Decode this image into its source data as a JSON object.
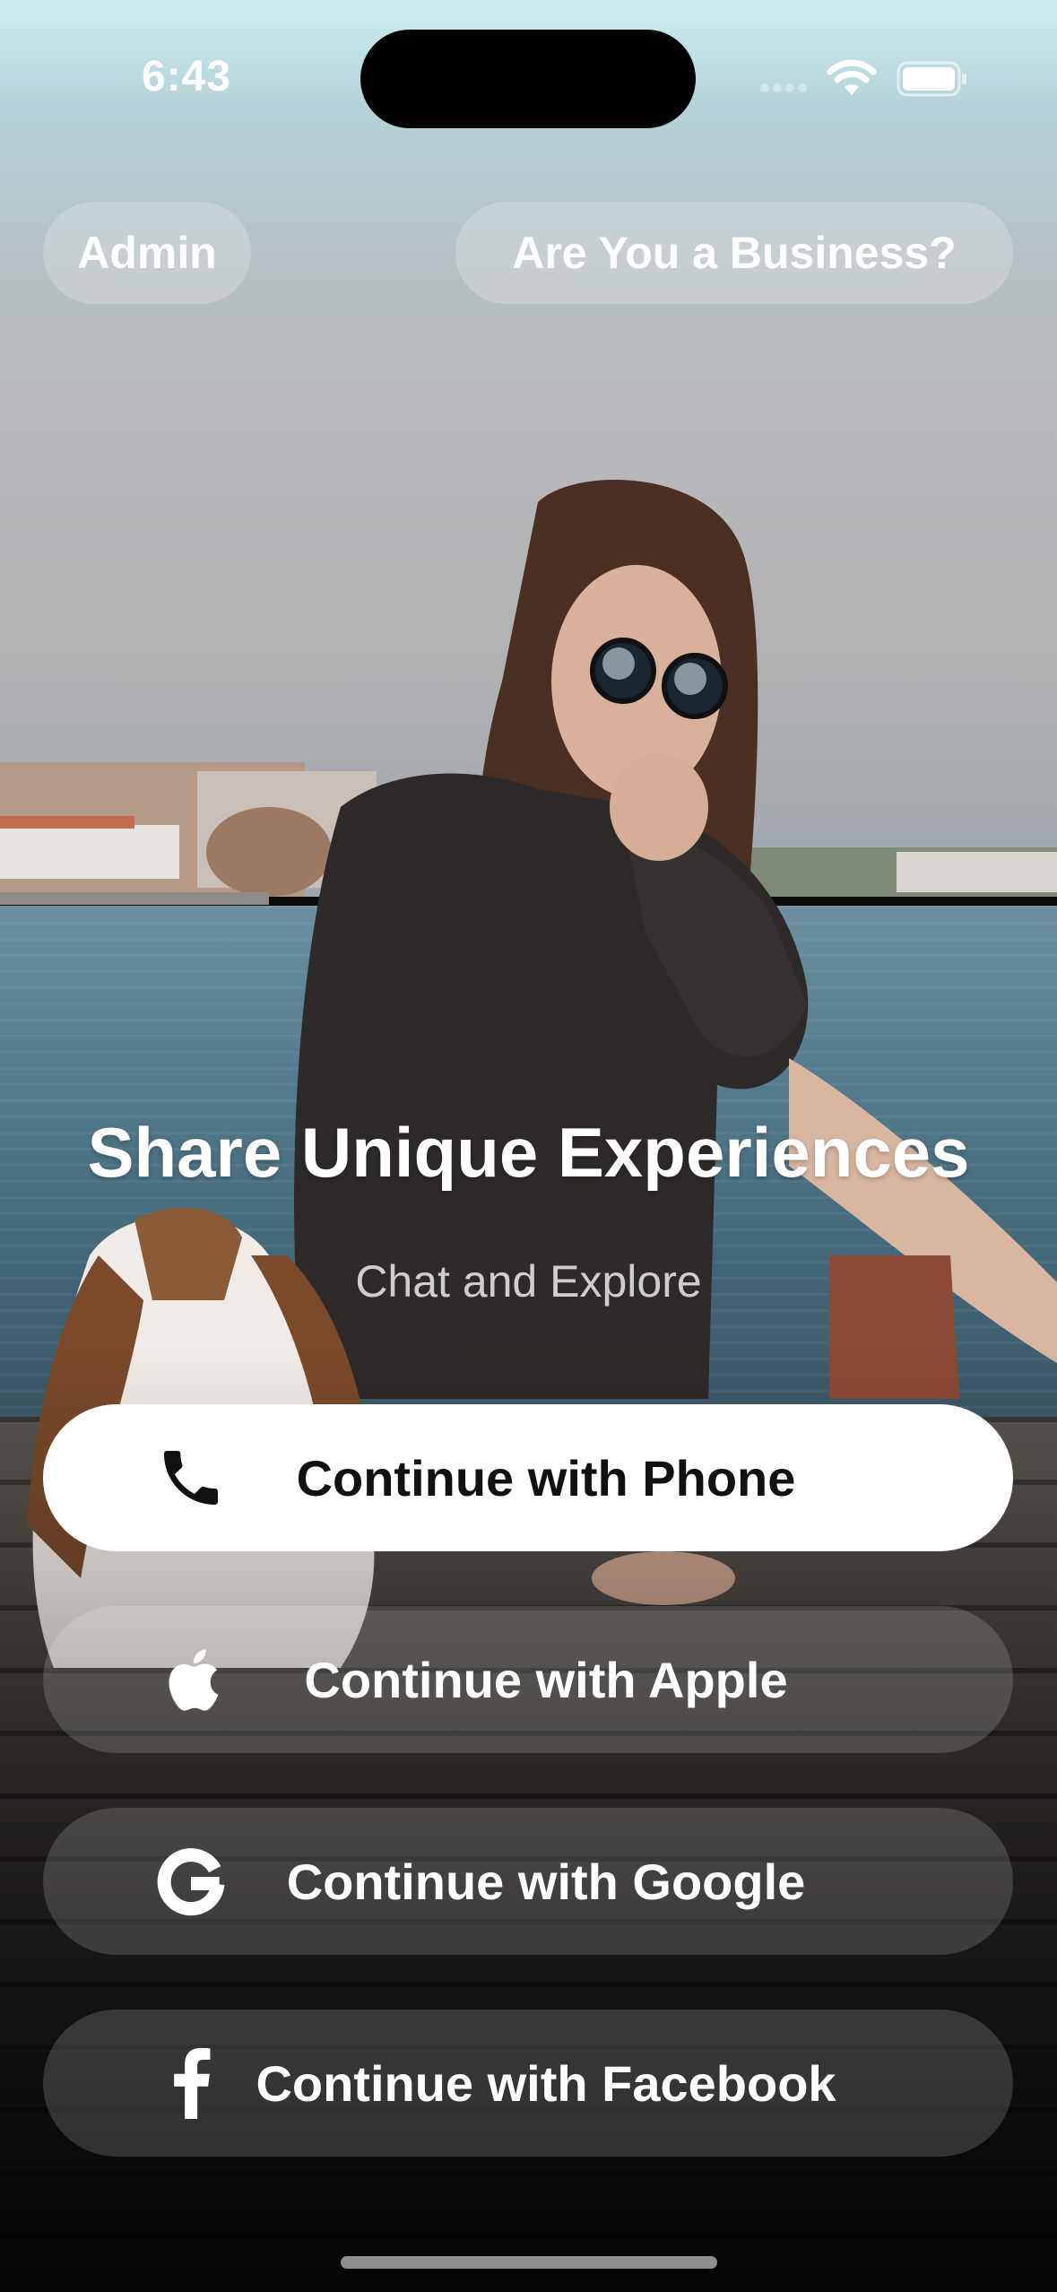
{
  "status_bar": {
    "time": "6:43"
  },
  "top_buttons": {
    "admin_label": "Admin",
    "business_label": "Are You a Business?"
  },
  "hero": {
    "title": "Share Unique Experiences",
    "subtitle": "Chat and Explore"
  },
  "auth_buttons": [
    {
      "label": "Continue with Phone",
      "icon": "phone-icon"
    },
    {
      "label": "Continue with Apple",
      "icon": "apple-icon"
    },
    {
      "label": "Continue with Google",
      "icon": "google-icon"
    },
    {
      "label": "Continue with Facebook",
      "icon": "facebook-icon"
    }
  ],
  "colors": {
    "primary_button_bg": "#ffffff",
    "primary_button_text": "#111111",
    "secondary_button_bg": "rgba(255,255,255,0.16)",
    "text": "#ffffff"
  }
}
